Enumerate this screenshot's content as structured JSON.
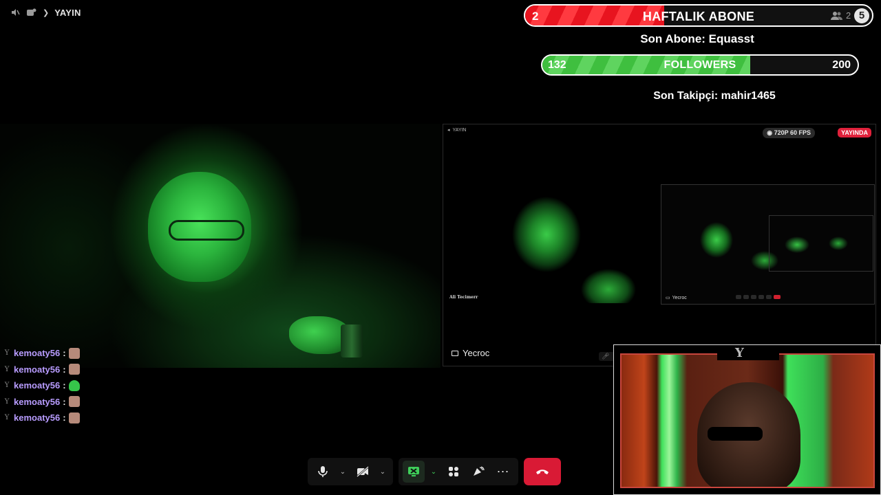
{
  "header": {
    "channel_label": "YAYIN",
    "icons": [
      "speaker-muted-icon",
      "channel-icon"
    ]
  },
  "subscriber_goal": {
    "current": "2",
    "title": "HAFTALIK ABONE",
    "people_count": "2",
    "target": "5",
    "progress_fraction": 0.4,
    "bar_color": "#e8141f",
    "last_subscriber_text": "Son Abone: Equasst"
  },
  "follower_goal": {
    "current": "132",
    "title": "FOLLOWERS",
    "target": "200",
    "progress_fraction": 0.66,
    "bar_color": "#3fbf3f",
    "last_follower_text": "Son Takipçi: mahir1465"
  },
  "screen_share": {
    "mini_header_label": "YAYIN",
    "quality_badge": "720P 60 FPS",
    "live_badge": "YAYINDA",
    "inner_name_tag": "Ali Tecimerr",
    "presenter_name": "Yecroc",
    "nested_presenter_name": "Yecroc"
  },
  "chat": {
    "messages": [
      {
        "user": "kemoaty56",
        "sep": ":",
        "emote": "emote-face-icon"
      },
      {
        "user": "kemoaty56",
        "sep": ":",
        "emote": "emote-face-icon"
      },
      {
        "user": "kemoaty56",
        "sep": ":",
        "emote": "emote-green-icon"
      },
      {
        "user": "kemoaty56",
        "sep": ":",
        "emote": "emote-face-icon"
      },
      {
        "user": "kemoaty56",
        "sep": ":",
        "emote": "emote-face-icon"
      }
    ]
  },
  "controls": {
    "buttons": [
      "microphone-icon",
      "camera-off-icon",
      "screen-share-icon",
      "activities-icon",
      "soundboard-icon",
      "more-icon",
      "end-call-icon"
    ],
    "end_call_color": "#d91a35"
  }
}
